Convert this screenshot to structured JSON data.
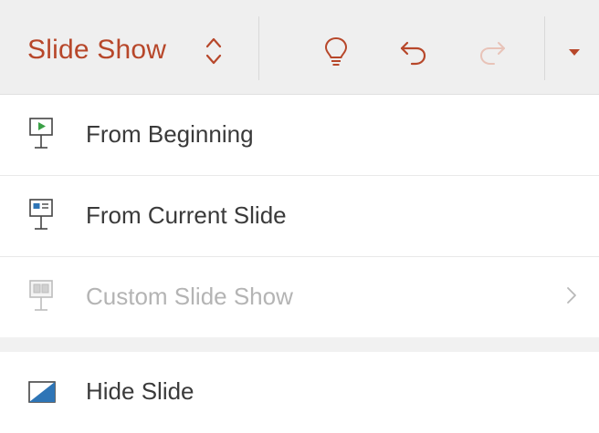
{
  "toolbar": {
    "tab_title": "Slide Show",
    "tab_switch_icon": "up-down-chevron-icon",
    "tell_me_icon": "lightbulb-icon",
    "undo_icon": "undo-icon",
    "redo_icon": "redo-icon",
    "more_icon": "dropdown-triangle-icon",
    "accent_color": "#b7472a",
    "background_color": "#efefef"
  },
  "menu": {
    "items": [
      {
        "label": "From Beginning",
        "icon": "play-from-beginning-icon",
        "enabled": true
      },
      {
        "label": "From Current Slide",
        "icon": "present-from-current-icon",
        "enabled": true
      },
      {
        "label": "Custom Slide Show",
        "icon": "custom-show-icon",
        "enabled": false,
        "has_submenu": true
      },
      {
        "label": "Hide Slide",
        "icon": "hide-slide-icon",
        "enabled": true
      }
    ]
  }
}
